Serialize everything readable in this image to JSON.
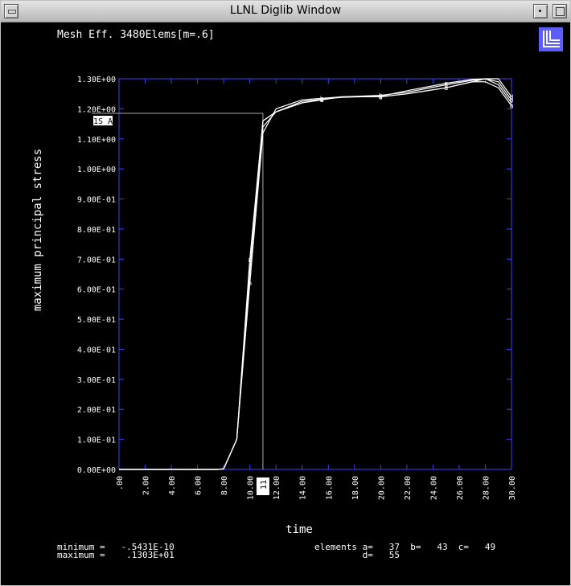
{
  "window": {
    "title": "LLNL Diglib Window"
  },
  "chart_data": {
    "type": "line",
    "title": "Mesh Eff. 3480Elems[m=.6]",
    "xlabel": "time",
    "ylabel": "maximum principal stress",
    "xlim": [
      0,
      30
    ],
    "ylim": [
      0,
      1.3
    ],
    "x_ticks": [
      0,
      2,
      4,
      6,
      8,
      10,
      12,
      14,
      16,
      18,
      20,
      22,
      24,
      26,
      28,
      30
    ],
    "x_tick_labels": [
      ".00",
      "2.00",
      "4.00",
      "6.00",
      "8.00",
      "10.00",
      "12.00",
      "14.00",
      "16.00",
      "18.00",
      "20.00",
      "22.00",
      "24.00",
      "26.00",
      "28.00",
      "30.00"
    ],
    "y_ticks": [
      0,
      0.1,
      0.2,
      0.3,
      0.4,
      0.5,
      0.6,
      0.7,
      0.8,
      0.9,
      1.0,
      1.1,
      1.2,
      1.3
    ],
    "y_tick_labels": [
      "0.00E+00",
      "1.00E-01",
      "2.00E-01",
      "3.00E-01",
      "4.00E-01",
      "5.00E-01",
      "6.00E-01",
      "7.00E-01",
      "8.00E-01",
      "9.00E-01",
      "1.00E+00",
      "1.10E+00",
      "1.20E+00",
      "1.30E+00"
    ],
    "series": [
      {
        "name": "a",
        "x": [
          0,
          7.5,
          8,
          9,
          10,
          11,
          12,
          14,
          15.5,
          17,
          20,
          22,
          25,
          27,
          28,
          29,
          30
        ],
        "y": [
          0,
          0,
          0.002,
          0.1,
          0.7,
          1.16,
          1.19,
          1.22,
          1.23,
          1.24,
          1.24,
          1.25,
          1.27,
          1.29,
          1.29,
          1.27,
          1.21
        ]
      },
      {
        "name": "b",
        "x": [
          0,
          7.5,
          8,
          9,
          10,
          11,
          12,
          14,
          15.5,
          17,
          20,
          22,
          25,
          27,
          28,
          29,
          30
        ],
        "y": [
          0,
          0,
          0.002,
          0.1,
          0.62,
          1.12,
          1.2,
          1.23,
          1.235,
          1.24,
          1.245,
          1.255,
          1.28,
          1.295,
          1.3,
          1.29,
          1.23
        ]
      },
      {
        "name": "c",
        "x": [
          0,
          7.5,
          8,
          9,
          10,
          11,
          12,
          14,
          15.5,
          17,
          20,
          22,
          25,
          27,
          28,
          29,
          30
        ],
        "y": [
          0,
          0,
          0.002,
          0.1,
          0.66,
          1.14,
          1.19,
          1.225,
          1.232,
          1.238,
          1.242,
          1.26,
          1.285,
          1.298,
          1.3,
          1.28,
          1.22
        ]
      },
      {
        "name": "d",
        "x": [
          0,
          7.5,
          8,
          9,
          10,
          11,
          12,
          14,
          15.5,
          17,
          20,
          22,
          25,
          27,
          28,
          29,
          30
        ],
        "y": [
          0,
          0,
          0.002,
          0.1,
          0.66,
          1.16,
          1.19,
          1.22,
          1.23,
          1.24,
          1.24,
          1.25,
          1.27,
          1.29,
          1.3,
          1.3,
          1.24
        ]
      }
    ],
    "cursor": {
      "x": 11,
      "y": 1.185,
      "x_label": "11",
      "y_label": "1S A"
    },
    "colors": {
      "background": "#000000",
      "frame": "#4040ff",
      "lines": "#ffffff",
      "logo": "#5d5dff"
    }
  },
  "footer": {
    "minimum_line": "minimum =   -.5431E-10",
    "maximum_line": "maximum =    .1303E+01",
    "elements_line1": "elements a=   37  b=   43  c=   49",
    "elements_line2": "         d=   55"
  }
}
